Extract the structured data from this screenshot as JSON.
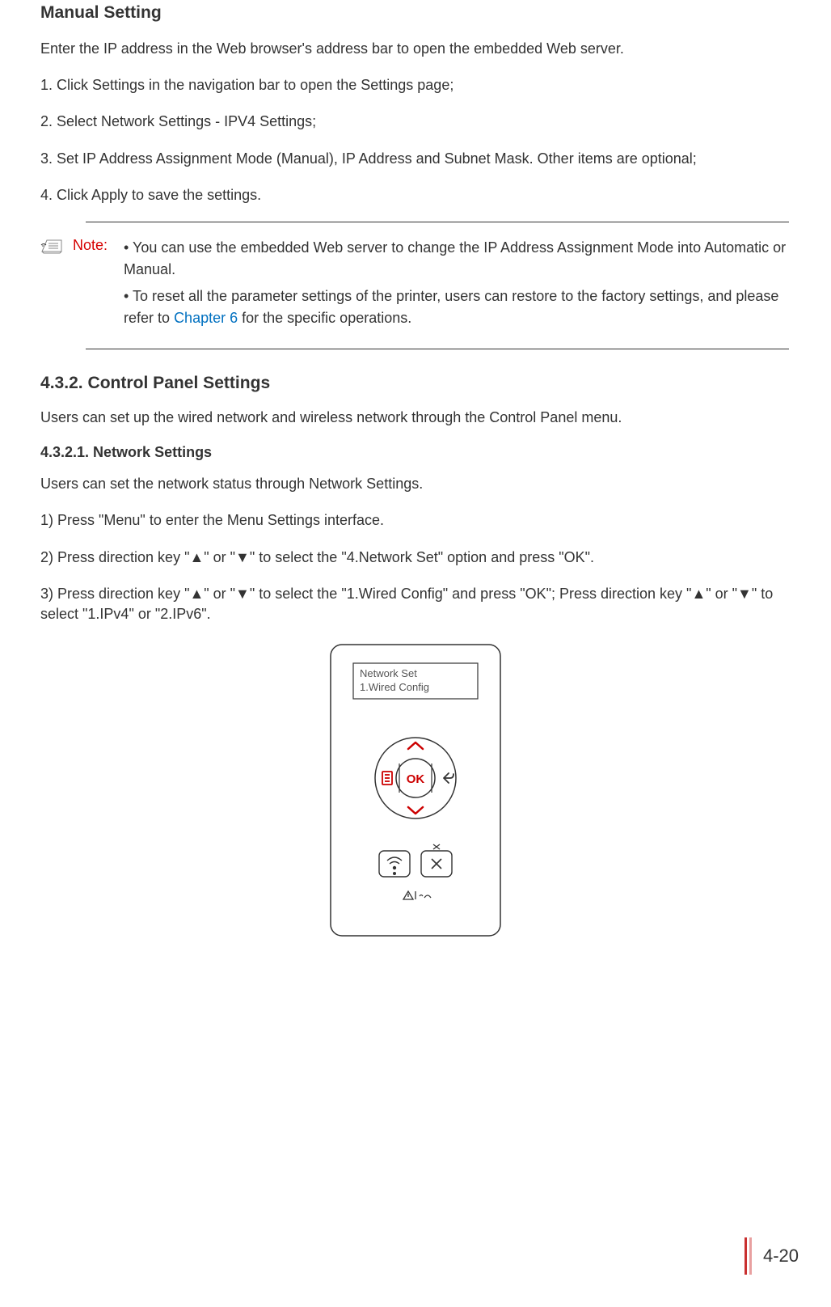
{
  "heading1": "Manual Setting",
  "p1": "Enter the IP address in the Web browser's address bar to open the embedded Web server.",
  "p2": "1. Click Settings in the navigation bar to open the Settings page;",
  "p3": "2. Select Network Settings - IPV4 Settings;",
  "p4": "3. Set IP Address Assignment Mode (Manual), IP Address and Subnet Mask. Other items are optional;",
  "p5": "4. Click Apply to save the settings.",
  "note": {
    "label": "Note:",
    "line1": "• You can use the embedded Web server to change the IP Address Assignment Mode into Automatic or Manual.",
    "line2a": "• To reset all the parameter settings of the printer, users can restore to the factory settings, and please refer to ",
    "line2link": "Chapter 6",
    "line2b": " for the specific operations."
  },
  "section432": "4.3.2. Control Panel Settings",
  "p6": "Users can set up the wired network and wireless network through the Control Panel menu.",
  "section4321": "4.3.2.1. Network Settings",
  "p7": "Users can set the network status through Network Settings.",
  "p8": "1) Press \"Menu\" to enter the Menu Settings interface.",
  "p9": "2) Press direction key \"▲\" or \"▼\" to select the \"4.Network Set\" option and press \"OK\".",
  "p10": "3) Press direction key \"▲\" or \"▼\" to select the \"1.Wired Config\" and press \"OK\"; Press direction key \"▲\" or \"▼\" to select \"1.IPv4\" or \"2.IPv6\".",
  "panel": {
    "line1": "Network Set",
    "line2": "1.Wired Config",
    "ok": "OK"
  },
  "pageNumber": "4-20"
}
